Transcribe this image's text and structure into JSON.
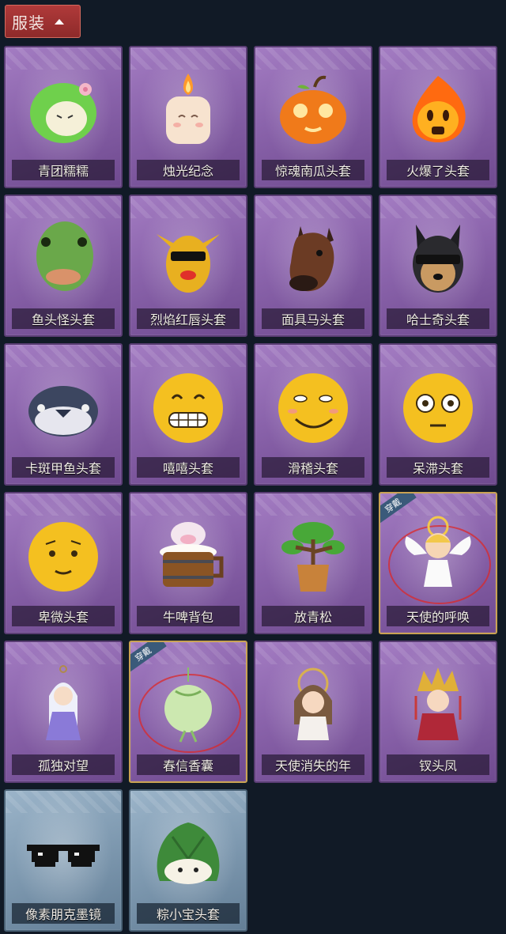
{
  "header": {
    "title": "服装"
  },
  "colors": {
    "background": "#111a26",
    "purple_card": "#8a63ab",
    "blue_card": "#7e99b0",
    "header_red": "#b03a3a",
    "worn_border": "#c9a253"
  },
  "items": [
    {
      "label": "青团糯糯",
      "icon": "green-bun-icon"
    },
    {
      "label": "烛光纪念",
      "icon": "candle-icon"
    },
    {
      "label": "惊魂南瓜头套",
      "icon": "pumpkin-icon"
    },
    {
      "label": "火爆了头套",
      "icon": "fire-face-icon"
    },
    {
      "label": "鱼头怪头套",
      "icon": "fish-head-icon"
    },
    {
      "label": "烈焰红唇头套",
      "icon": "pikachu-mask-icon"
    },
    {
      "label": "面具马头套",
      "icon": "horse-mask-icon"
    },
    {
      "label": "哈士奇头套",
      "icon": "husky-mask-icon"
    },
    {
      "label": "卡斑甲鱼头套",
      "icon": "fish-mask-icon"
    },
    {
      "label": "嘻嘻头套",
      "icon": "grin-emoji-icon"
    },
    {
      "label": "滑稽头套",
      "icon": "smirk-emoji-icon"
    },
    {
      "label": "呆滞头套",
      "icon": "dazed-emoji-icon"
    },
    {
      "label": "卑微头套",
      "icon": "humble-emoji-icon"
    },
    {
      "label": "牛啤背包",
      "icon": "cow-beer-icon"
    },
    {
      "label": "放青松",
      "icon": "bonsai-icon"
    },
    {
      "label": "天使的呼唤",
      "icon": "angel-icon",
      "worn": "穿戴"
    },
    {
      "label": "孤独对望",
      "icon": "doll-pendant-icon"
    },
    {
      "label": "春信香囊",
      "icon": "sachet-icon",
      "worn": "穿戴"
    },
    {
      "label": "天使消失的年",
      "icon": "angel-girl-icon"
    },
    {
      "label": "钗头凤",
      "icon": "phoenix-crown-icon"
    },
    {
      "label": "像素朋克墨镜",
      "icon": "pixel-sunglasses-icon",
      "blue": true
    },
    {
      "label": "粽小宝头套",
      "icon": "zongzi-mask-icon",
      "blue": true
    }
  ]
}
